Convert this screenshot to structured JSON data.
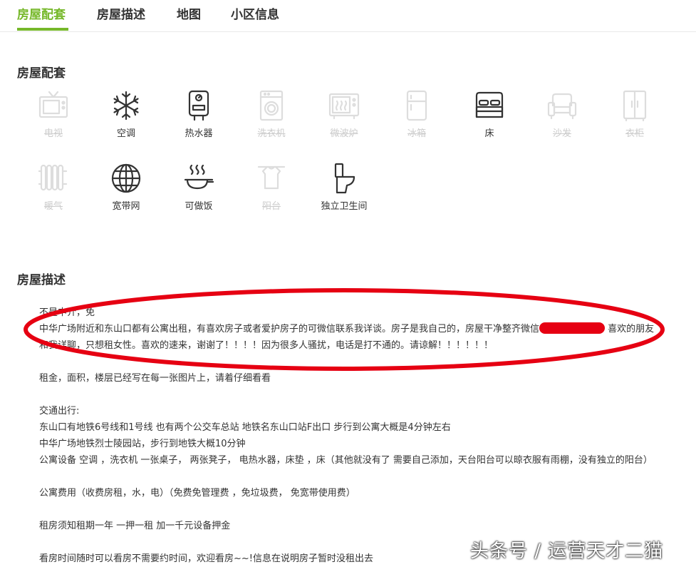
{
  "tabs": [
    "房屋配套",
    "房屋描述",
    "地图",
    "小区信息"
  ],
  "facilities_section": {
    "title": "房屋配套",
    "items": [
      {
        "label": "电视",
        "icon": "tv-icon",
        "available": false
      },
      {
        "label": "空调",
        "icon": "snowflake-icon",
        "available": true
      },
      {
        "label": "热水器",
        "icon": "water-heater-icon",
        "available": true
      },
      {
        "label": "洗衣机",
        "icon": "washing-machine-icon",
        "available": false
      },
      {
        "label": "微波炉",
        "icon": "microwave-icon",
        "available": false
      },
      {
        "label": "冰箱",
        "icon": "fridge-icon",
        "available": false
      },
      {
        "label": "床",
        "icon": "bed-icon",
        "available": true
      },
      {
        "label": "沙发",
        "icon": "sofa-icon",
        "available": false
      },
      {
        "label": "衣柜",
        "icon": "wardrobe-icon",
        "available": false
      },
      {
        "label": "暖气",
        "icon": "radiator-icon",
        "available": false
      },
      {
        "label": "宽带网",
        "icon": "globe-icon",
        "available": true
      },
      {
        "label": "可做饭",
        "icon": "cooking-pan-icon",
        "available": true
      },
      {
        "label": "阳台",
        "icon": "balcony-icon",
        "available": false
      },
      {
        "label": "独立卫生间",
        "icon": "toilet-icon",
        "available": true
      }
    ]
  },
  "description_section": {
    "title": "房屋描述",
    "line1": "不是中介，免",
    "line2_before": "中华广场附近和东山口都有公寓出租，有喜欢房子或者爱护房子的可微信联系我详谈。房子是我自己的，房屋干净整齐微信",
    "line2_after": " 喜欢的朋友",
    "line3": "和我详聊，只想租女性。喜欢的速来，谢谢了！！！！因为很多人骚扰，电话是打不通的。请谅解！！！！！！",
    "line4": "租金，面积，楼层已经写在每一张图片上，请着仔细看看",
    "line5": "交通出行:",
    "line6": "东山口有地铁6号线和1号线 也有两个公交车总站 地铁名东山口站F出口 步行到公寓大概是4分钟左右",
    "line7": "中华广场地铁烈士陵园站，步行到地铁大概10分钟",
    "line8": "公寓设备 空调 ，洗衣机 一张桌子， 两张凳子， 电热水器，床垫 ，床（其他就没有了 需要自己添加，天台阳台可以晾衣服有雨棚，没有独立的阳台）",
    "line9": "公寓费用（收费房租，水，电）（免费免管理费 ，免垃圾费， 免宽带使用费）",
    "line10": "租房须知租期一年 一押一租 加一千元设备押金",
    "line11": "看房时间随时可以看房不需要约时间，欢迎看房~~!信息在说明房子暂时没租出去"
  },
  "watermark": "头条号 / 运营天才二猫",
  "colors": {
    "accent": "#76b82a",
    "annotation": "#e60012"
  }
}
